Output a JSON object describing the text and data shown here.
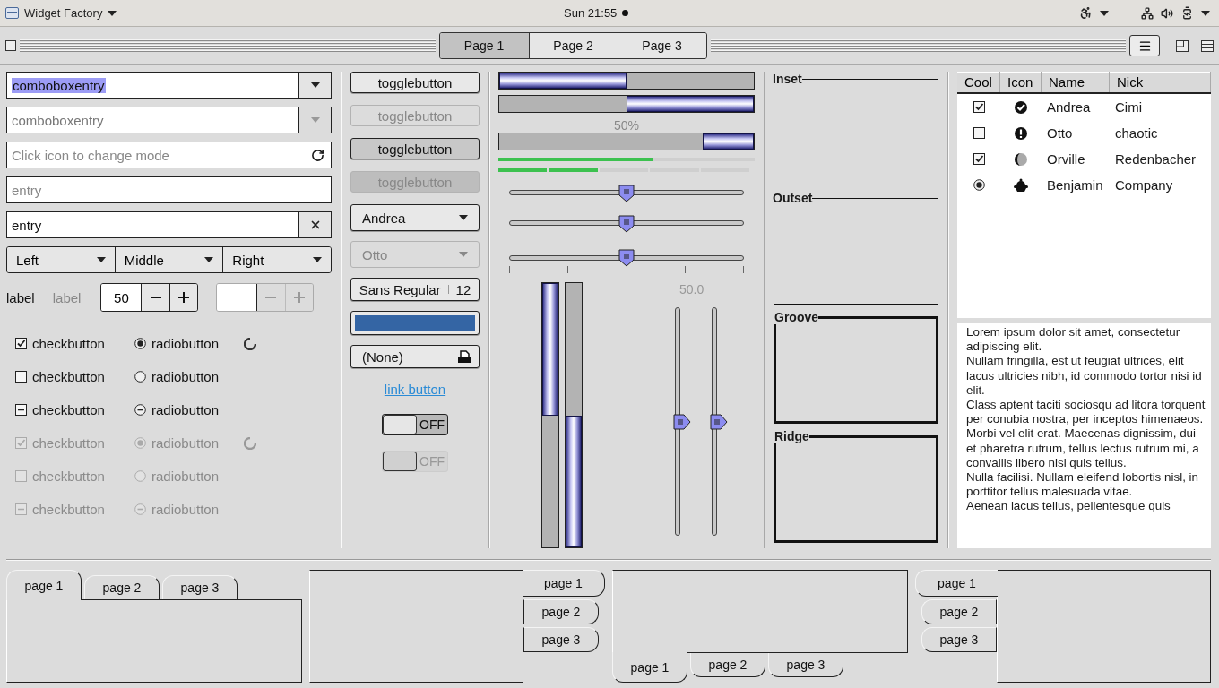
{
  "top_bar": {
    "app_menu": "Widget Factory",
    "clock": "Sun 21:55"
  },
  "header_tabs": [
    {
      "label": "Page 1",
      "selected": true
    },
    {
      "label": "Page 2",
      "selected": false
    },
    {
      "label": "Page 3",
      "selected": false
    }
  ],
  "entries": [
    {
      "kind": "combo",
      "value": "comboboxentry",
      "selection": true,
      "disabled": false
    },
    {
      "kind": "combo",
      "value": "comboboxentry",
      "selection": false,
      "disabled": true
    },
    {
      "kind": "icon",
      "placeholder": "Click icon to change mode"
    },
    {
      "kind": "plain",
      "placeholder": "entry"
    },
    {
      "kind": "clear",
      "value": "entry"
    }
  ],
  "segmented": [
    {
      "label": "Left"
    },
    {
      "label": "Middle"
    },
    {
      "label": "Right"
    }
  ],
  "labels": [
    {
      "text": "label",
      "disabled": false
    },
    {
      "text": "label",
      "disabled": true
    }
  ],
  "spin_buttons": [
    {
      "value": "50",
      "disabled": false
    },
    {
      "disabled": true
    }
  ],
  "check_rows": [
    {
      "check": {
        "label": "checkbutton",
        "checked": true,
        "inconsistent": false
      },
      "radio": {
        "label": "radiobutton",
        "checked": true,
        "inconsistent": false
      },
      "spinner": true,
      "disabled": false
    },
    {
      "check": {
        "label": "checkbutton",
        "checked": false,
        "inconsistent": false
      },
      "radio": {
        "label": "radiobutton",
        "checked": false,
        "inconsistent": false
      },
      "spinner": false,
      "disabled": false
    },
    {
      "check": {
        "label": "checkbutton",
        "inconsistent": true
      },
      "radio": {
        "label": "radiobutton",
        "inconsistent": true
      },
      "spinner": false,
      "disabled": false
    },
    {
      "check": {
        "label": "checkbutton",
        "checked": true,
        "inconsistent": false
      },
      "radio": {
        "label": "radiobutton",
        "checked": true,
        "inconsistent": false
      },
      "spinner": true,
      "disabled": true
    },
    {
      "check": {
        "label": "checkbutton",
        "checked": false,
        "inconsistent": false
      },
      "radio": {
        "label": "radiobutton",
        "checked": false,
        "inconsistent": false
      },
      "spinner": false,
      "disabled": true
    },
    {
      "check": {
        "label": "checkbutton",
        "inconsistent": true
      },
      "radio": {
        "label": "radiobutton",
        "inconsistent": true
      },
      "spinner": false,
      "disabled": true
    }
  ],
  "toggle_buttons": [
    {
      "label": "togglebutton",
      "active": false,
      "disabled": false
    },
    {
      "label": "togglebutton",
      "active": false,
      "disabled": true
    },
    {
      "label": "togglebutton",
      "active": true,
      "disabled": false
    },
    {
      "label": "togglebutton",
      "active": true,
      "disabled": true
    }
  ],
  "combo_boxes": [
    {
      "value": "Andrea",
      "disabled": false
    },
    {
      "value": "Otto",
      "disabled": true
    }
  ],
  "font_button": {
    "family": "Sans Regular",
    "size": "12"
  },
  "file_button": {
    "value": "(None)"
  },
  "link_button": {
    "label": "link button"
  },
  "switches": [
    {
      "label": "OFF",
      "on": false,
      "disabled": false
    },
    {
      "label": "OFF",
      "on": false,
      "disabled": true
    }
  ],
  "progress_bars": [
    {
      "kind": "bar",
      "level": 0.5,
      "inverted": false
    },
    {
      "kind": "bar",
      "level": 0.5,
      "inverted": true
    },
    {
      "kind": "bar",
      "level": 0.2,
      "inverted": true,
      "text": "50%"
    }
  ],
  "level_bars": [
    {
      "kind": "continuous",
      "level": 0.6
    },
    {
      "kind": "discrete",
      "level": 0.4
    }
  ],
  "scales": [
    {
      "level": 0.5,
      "marks": false
    },
    {
      "level": 0.5,
      "marks": false
    },
    {
      "level": 0.5,
      "marks": true
    }
  ],
  "vertical_progress": [
    {
      "level": 0.5,
      "inverted": true
    },
    {
      "level": 0.5,
      "inverted": false
    }
  ],
  "vertical_scales": {
    "value": "50.0",
    "scales": [
      {
        "level": 0.5
      },
      {
        "level": 0.5
      }
    ]
  },
  "frames": [
    {
      "label": "Inset",
      "kind": "inset"
    },
    {
      "label": "Outset",
      "kind": "outset"
    },
    {
      "label": "Groove",
      "kind": "groove"
    },
    {
      "label": "Ridge",
      "kind": "ridge"
    }
  ],
  "tree": {
    "columns": [
      "Cool",
      "Icon",
      "Name",
      "Nick"
    ],
    "rows": [
      {
        "cool": {
          "kind": "check",
          "checked": true
        },
        "name": "Andrea",
        "nick": "Cimi"
      },
      {
        "cool": {
          "kind": "check",
          "checked": false
        },
        "name": "Otto",
        "nick": "chaotic"
      },
      {
        "cool": {
          "kind": "check",
          "checked": true
        },
        "name": "Orville",
        "nick": "Redenbacher"
      },
      {
        "cool": {
          "kind": "radio",
          "checked": true
        },
        "name": "Benjamin",
        "nick": "Company"
      }
    ]
  },
  "text_view": {
    "paragraphs": [
      "Lorem ipsum dolor sit amet, consectetur adipiscing elit.",
      "Nullam fringilla, est ut feugiat ultrices, elit lacus ultricies nibh, id commodo tortor nisi id elit.",
      "Class aptent taciti sociosqu ad litora torquent per conubia nostra, per inceptos himenaeos.",
      "Morbi vel elit erat. Maecenas dignissim, dui et pharetra rutrum, tellus lectus rutrum mi, a convallis libero nisi quis tellus.",
      "Nulla facilisi. Nullam eleifend lobortis nisl, in porttitor tellus malesuada vitae.",
      "Aenean lacus tellus, pellentesque quis"
    ]
  },
  "notebooks": [
    {
      "kind": "top",
      "tabs": [
        {
          "label": "page 1",
          "selected": true
        },
        {
          "label": "page 2",
          "selected": false
        },
        {
          "label": "page 3",
          "selected": false
        }
      ]
    },
    {
      "kind": "right",
      "tabs": [
        {
          "label": "page 1",
          "selected": true
        },
        {
          "label": "page 2",
          "selected": false
        },
        {
          "label": "page 3",
          "selected": false
        }
      ]
    },
    {
      "kind": "bottom",
      "tabs": [
        {
          "label": "page 1",
          "selected": true
        },
        {
          "label": "page 2",
          "selected": false
        },
        {
          "label": "page 3",
          "selected": false
        }
      ]
    },
    {
      "kind": "left",
      "tabs": [
        {
          "label": "page 1",
          "selected": true
        },
        {
          "label": "page 2",
          "selected": false
        },
        {
          "label": "page 3",
          "selected": false
        }
      ]
    }
  ]
}
